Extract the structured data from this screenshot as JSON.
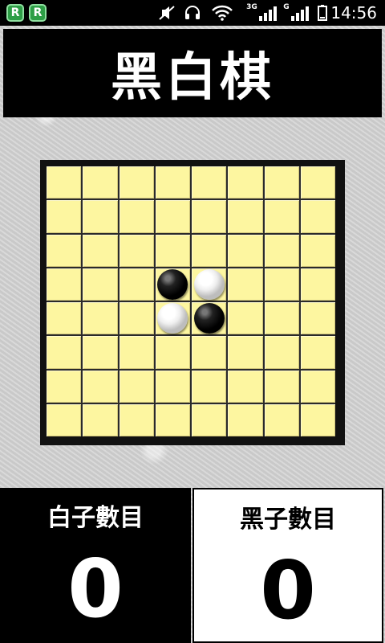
{
  "status_bar": {
    "badges": [
      "R",
      "R"
    ],
    "network_labels": [
      "3G",
      "G"
    ],
    "time": "14:56",
    "icons": [
      "app-badge-icon",
      "mute-icon",
      "headphones-icon",
      "wifi-icon",
      "signal-3g-icon",
      "signal-g-icon",
      "battery-icon"
    ]
  },
  "title": "黑白棋",
  "board": {
    "size": 8,
    "cell_color": "#fdf6a0",
    "stones": [
      {
        "row": 4,
        "col": 4,
        "color": "black"
      },
      {
        "row": 4,
        "col": 5,
        "color": "white"
      },
      {
        "row": 5,
        "col": 4,
        "color": "white"
      },
      {
        "row": 5,
        "col": 5,
        "color": "black"
      }
    ]
  },
  "scores": {
    "white": {
      "label": "白子數目",
      "value": "0"
    },
    "black": {
      "label": "黑子數目",
      "value": "0"
    }
  },
  "colors": {
    "panel_dark": "#000000",
    "panel_light": "#ffffff",
    "board_cell": "#fdf6a0"
  }
}
